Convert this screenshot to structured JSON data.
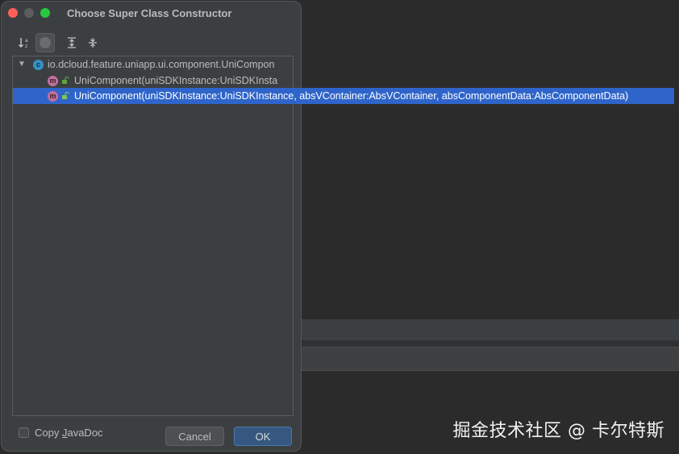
{
  "dialog": {
    "title": "Choose Super Class Constructor"
  },
  "toolbar": {
    "icons": [
      "sort-alphabetically-icon",
      "filter-icon",
      "expand-all-icon",
      "collapse-all-icon"
    ]
  },
  "tree": {
    "root_label": "io.dcloud.feature.uniapp.ui.component.UniCompon",
    "items": [
      {
        "label": "UniComponent(uniSDKInstance:UniSDKInsta",
        "selected": false
      },
      {
        "label": "UniComponent(uniSDKInstance:UniSDKInstance, absVContainer:AbsVContainer, absComponentData:AbsComponentData)",
        "selected": true
      }
    ]
  },
  "footer": {
    "copy_javadoc_prefix": "Copy ",
    "copy_javadoc_mnemonic": "J",
    "copy_javadoc_suffix": "avaDoc",
    "copy_javadoc_checked": false,
    "cancel_label": "Cancel",
    "ok_label": "OK"
  },
  "watermark": "掘金技术社区 @ 卡尔特斯",
  "colors": {
    "selection": "#2f65ca",
    "ok_button": "#365880",
    "class_icon": "#3592c4",
    "method_icon": "#c26f9b",
    "close": "#ff5f57",
    "maximize": "#28c840"
  }
}
